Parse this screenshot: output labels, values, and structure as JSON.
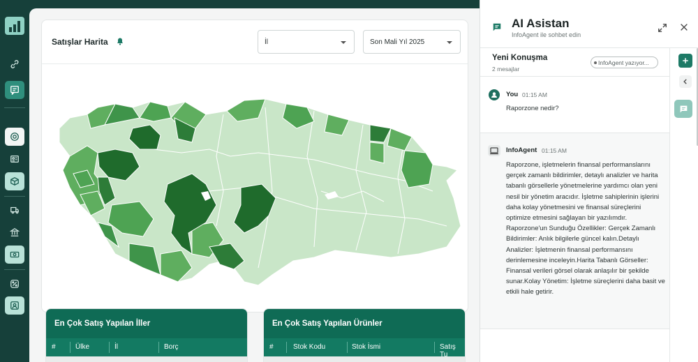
{
  "map_card": {
    "title": "Satışlar Harita",
    "province_select": "İl",
    "period_select": "Son Mali Yıl 2025"
  },
  "tables": {
    "provinces": {
      "title": "En Çok Satış Yapılan İller",
      "columns": [
        "#",
        "Ülke",
        "İl",
        "Borç"
      ]
    },
    "products": {
      "title": "En Çok Satış Yapılan Ürünler",
      "columns": [
        "#",
        "Stok Kodu",
        "Stok İsmi",
        "Satış Tu"
      ]
    }
  },
  "assistant": {
    "title": "AI Asistan",
    "subtitle": "InfoAgent ile sohbet edin",
    "conversation_title": "Yeni Konuşma",
    "message_count": "2 mesajlar",
    "typing_status": "InfoAgent yazıyor...",
    "messages": [
      {
        "author": "You",
        "time": "01:15 AM",
        "text": "Raporzone nedir?"
      },
      {
        "author": "InfoAgent",
        "time": "01:15 AM",
        "text": "Raporzone, işletmelerin finansal performanslarını gerçek zamanlı bildirimler, detaylı analizler ve harita tabanlı görsellerle yönetmelerine yardımcı olan yeni nesil bir yönetim aracıdır. İşletme sahiplerinin işlerini daha kolay yönetmesini ve finansal süreçlerini optimize etmesini sağlayan bir yazılımdır. Raporzone'un Sunduğu Özellikler: Gerçek Zamanlı Bildirimler: Anlık bilgilerle güncel kalın.Detaylı Analizler: İşletmenin finansal performansını derinlemesine inceleyin.Harita Tabanlı Görseller: Finansal verileri görsel olarak anlaşılır bir şekilde sunar.Kolay Yönetim: İşletme süreçlerini daha basit ve etkili hale getirir."
      }
    ]
  },
  "icons": {
    "rail": [
      "logo-icon",
      "link-icon",
      "chat-icon",
      "dashboard-icon",
      "contact-card-icon",
      "box-icon",
      "truck-icon",
      "bank-icon",
      "money-icon",
      "percent-icon",
      "user-icon"
    ]
  },
  "colors": {
    "sidebar": "#16403a",
    "accent": "#1d7a66",
    "table_header": "#0f6b55",
    "map_light": "#c9e6c8",
    "map_mid": "#5fae5f",
    "map_dark": "#1f6b2c"
  }
}
